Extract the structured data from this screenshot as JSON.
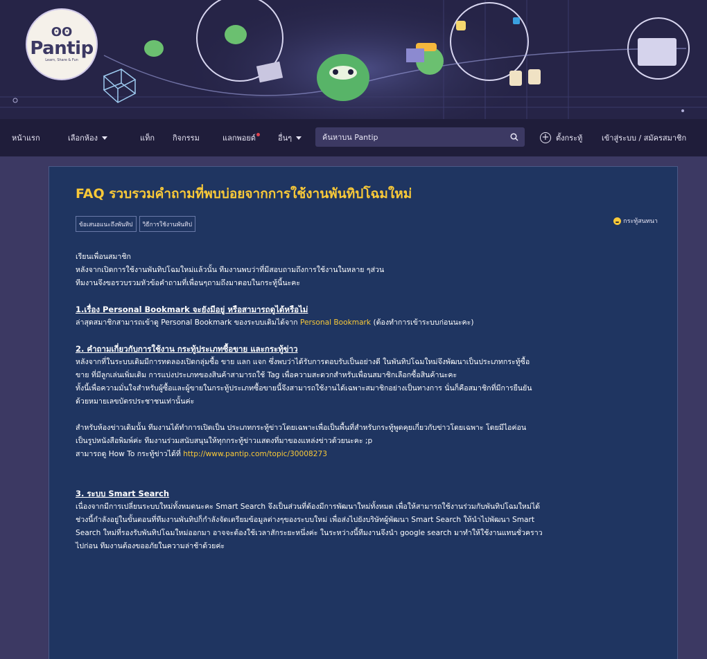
{
  "banner": {
    "logo_mark": "ʘʘ",
    "logo_text": "Pantip",
    "logo_tagline": "Learn, Share & Fun"
  },
  "nav": {
    "items": [
      {
        "label": "หน้าแรก"
      },
      {
        "label": "เลือกห้อง"
      },
      {
        "label": "แท็ก"
      },
      {
        "label": "กิจกรรม"
      },
      {
        "label": "แลกพอยต์"
      },
      {
        "label": "อื่นๆ"
      }
    ],
    "search_placeholder": "ค้นหาบน Pantip",
    "new_topic": "ตั้งกระทู้",
    "login": "เข้าสู่ระบบ / สมัครสมาชิก"
  },
  "topic": {
    "title": "FAQ รวบรวมคำถามที่พบบ่อยจากการใช้งานพันทิปโฉมใหม่",
    "tags": [
      "ข้อเสนอแนะถึงพันทิป",
      "วิธีการใช้งานพันทิป"
    ],
    "type_label": "กระทู้สนทนา",
    "greeting": "เรียนเพื่อนสมาชิก",
    "intro_1": "หลังจากเปิดการใช้งานพันทิปโฉมใหม่แล้วนั้น ทีมงานพบว่าที่มีสอบถามถึงการใช้งานในหลาย ๆส่วน",
    "intro_2": "ทีมงานจึงขอรวบรวมหัวข้อคำถามที่เพื่อนๆถามถึงมาตอบในกระทู้นี้นะคะ",
    "s1_heading": "1.เรื่อง Personal Bookmark จะยังมีอยู่ หรือสามารถดูได้หรือไม่",
    "s1_text_a": "ล่าสุดสมาชิกสามารถเข้าดู Personal Bookmark ของระบบเดิมได้จาก",
    "s1_link": "Personal Bookmark",
    "s1_text_b": "(ต้องทำการเข้าระบบก่อนนะคะ)",
    "s2_heading": "2. คำถามเกี่ยวกับการใช้งาน กระทู้ประเภทซื้อขาย และกระทู้ข่าว",
    "s2_p1_l1": "หลังจากที่ในระบบเดิมมีการทดลองเปิดกลุ่มซื้อ ขาย แลก แจก ซึ่งพบว่าได้รับการตอบรับเป็นอย่างดี ในพันทิปโฉมใหม่จึงพัฒนาเป็นประเภทกระทู้ซื้อ",
    "s2_p1_l2": "ขาย ที่มีลูกเล่นเพิ่มเติม การแบ่งประเภทของสินค้าสามารถใช้ Tag เพื่อความสะดวกสำหรับเพื่อนสมาชิกเลือกซื้อสินค้านะคะ",
    "s2_p1_l3": "ทั้งนี้เพื่อความมั่นใจสำหรับผู้ซื้อและผู้ขายในกระทู้ประเภทซื้อขายนี้จึงสามารถใช้งานได้เฉพาะสมาชิกอย่างเป็นทางการ นั่นก็คือสมาชิกที่มีการยืนยัน",
    "s2_p1_l4": "ด้วยหมายเลขบัตรประชาชนเท่านั้นค่ะ",
    "s2_p2_l1": "สำหรับห้องข่าวเดิมนั้น ทีมงานได้ทำการเปิดเป็น ประเภทกระทู้ข่าวโดยเฉพาะเพื่อเป็นพื้นที่สำหรับกระทู้พูดคุยเกี่ยวกับข่าวโดยเฉพาะ โดยมีไอค่อน",
    "s2_p2_l2": "เป็นรูปหนังสือพิมพ์ค่ะ ทีมงานร่วมสนับสนุนให้ทุกกระทู้ข่าวแสดงที่มาของแหล่งข่าวด้วยนะคะ ;p",
    "s2_p2_l3_a": "สามารถดู How To กระทู้ข่าวได้ที่",
    "s2_p2_link": "http://www.pantip.com/topic/30008273",
    "s3_heading": "3. ระบบ Smart Search",
    "s3_l1": "เนื่องจากมีการเปลี่ยนระบบใหม่ทั้งหมดนะคะ Smart Search จึงเป็นส่วนที่ต้องมีการพัฒนาใหม่ทั้งหมด เพื่อให้สามารถใช้งานร่วมกับพันทิปโฉมใหม่ได้",
    "s3_l2": "ช่วงนี้กำลังอยู่ในขั้นตอนที่ทีมงานพันทิปก็กำลังจัดเตรียมข้อมูลต่างๆของระบบใหม่ เพื่อส่งไปยังบริษัทผู้พัฒนา Smart Search ให้นำไปพัฒนา Smart",
    "s3_l3": "Search ใหม่ที่รองรับพันทิปโฉมใหม่ออกมา อาจจะต้องใช้เวลาสักระยะหนึ่งค่ะ ในระหว่างนี้ทีมงานจึงนำ google search มาทำให้ใช้งานแทนชั่วคราว",
    "s3_l4": "ไปก่อน ทีมงานต้องขออภัยในความล่าช้าด้วยค่ะ"
  },
  "colors": {
    "page_bg": "#3c3963",
    "nav_bg": "#1f1d3a",
    "card_bg": "#1f3561",
    "accent_yellow": "#f9c938"
  }
}
